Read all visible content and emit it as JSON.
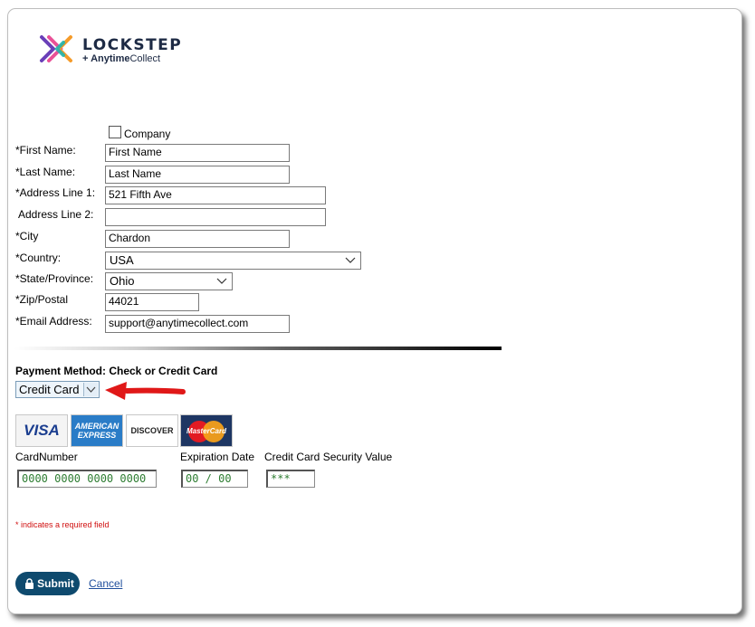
{
  "brand": {
    "name": "LOCKSTEP",
    "sub_bold": "+ Anytime",
    "sub_rest": "Collect",
    "colors": {
      "x_purple": "#6a3fb8",
      "x_pink": "#e83e8c",
      "x_orange": "#f59b2a",
      "x_teal": "#1fb5b0",
      "text": "#1d2a44"
    }
  },
  "form": {
    "company_label": "Company",
    "company_checked": false,
    "fields": {
      "first_name": {
        "label": "*First Name:",
        "value": "First Name"
      },
      "last_name": {
        "label": "*Last Name:",
        "value": "Last Name"
      },
      "address1": {
        "label": "*Address Line 1:",
        "value": "521 Fifth Ave"
      },
      "address2": {
        "label": "Address Line 2:",
        "value": ""
      },
      "city": {
        "label": "*City",
        "value": "Chardon"
      },
      "country": {
        "label": "*Country:",
        "value": "USA"
      },
      "state": {
        "label": "*State/Province:",
        "value": "Ohio"
      },
      "zip": {
        "label": "*Zip/Postal",
        "value": "44021"
      },
      "email": {
        "label": "*Email Address:",
        "value": "support@anytimecollect.com"
      }
    }
  },
  "payment": {
    "method_label": "Payment Method: Check or Credit Card",
    "method_value": "Credit Card",
    "cards": {
      "visa": "VISA",
      "amex_top": "AMERICAN",
      "amex_bottom": "EXPRESS",
      "discover": "DISCOVER",
      "mastercard": "MasterCard"
    },
    "card_number": {
      "label": "CardNumber",
      "placeholder": "0000 0000 0000 0000"
    },
    "expiration": {
      "label": "Expiration Date",
      "placeholder": "00 / 00"
    },
    "security": {
      "label": "Credit Card Security Value",
      "placeholder": "***"
    }
  },
  "footer": {
    "required_note": "* indicates a required field",
    "submit_label": "Submit",
    "cancel_label": "Cancel"
  },
  "accent": {
    "arrow": "#e01818",
    "submit_bg": "#0e4a6e",
    "link": "#1f4e9c",
    "required": "#d01010"
  }
}
